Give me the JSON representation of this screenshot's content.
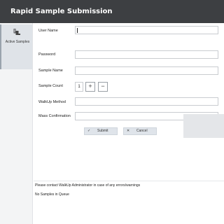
{
  "window": {
    "title": "Rapid Sample Submission"
  },
  "sidebar": {
    "items": [
      {
        "label": "Active Samples",
        "icon": "sample-vial-icon"
      }
    ]
  },
  "form": {
    "user_name_label": "User Name",
    "user_name_value": "",
    "password_label": "Password",
    "password_value": "",
    "sample_name_label": "Sample Name",
    "sample_name_value": "",
    "sample_count_label": "Sample Count",
    "sample_count_value": "1",
    "increment_label": "+",
    "decrement_label": "−",
    "walkup_method_label": "WalkUp Method",
    "walkup_method_value": "",
    "mass_confirmation_label": "Mass Confirmation",
    "mass_confirmation_value": ""
  },
  "actions": {
    "submit_label": "Submit",
    "submit_icon": "check-icon",
    "cancel_label": "Cancel",
    "cancel_icon": "close-icon"
  },
  "footer": {
    "contact_note": "Please contact WalkUp Administrator in case of any errors/warnings",
    "queue_status": "No Samples in Queue"
  },
  "colors": {
    "titlebar": "#3d3f42",
    "sidebar_active": "#dfe3e8",
    "button": "#dfe4ea"
  }
}
